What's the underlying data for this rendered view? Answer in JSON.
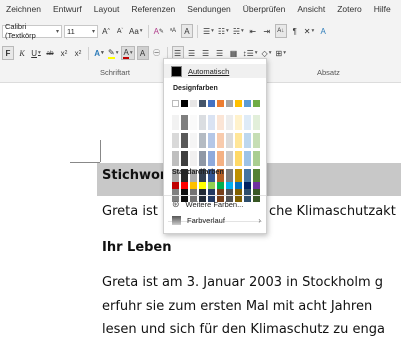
{
  "ribbon": {
    "tabs": [
      "Zeichnen",
      "Entwurf",
      "Layout",
      "Referenzen",
      "Sendungen",
      "Überprüfen",
      "Ansicht",
      "Zotero",
      "Hilfe"
    ],
    "font_name": "Calibri (Textkörp",
    "font_size": "11",
    "groups": {
      "schriftart": "Schriftart",
      "absatz": "Absatz"
    }
  },
  "menu": {
    "automatic_label": "Automatisch",
    "design_colors_title": "Designfarben",
    "standard_colors_title": "Standardfarben",
    "more_colors_label": "Weitere Farben...",
    "gradient_label": "Farbverlauf",
    "theme_top_row": [
      "#ffffff",
      "#000000",
      "#e7e6e6",
      "#44546a",
      "#4472c4",
      "#ed7d31",
      "#a5a5a5",
      "#ffc000",
      "#5b9bd5",
      "#70ad47"
    ],
    "standard_colors": [
      "#c00000",
      "#ff0000",
      "#ffc000",
      "#ffff00",
      "#92d050",
      "#00b050",
      "#00b0f0",
      "#0070c0",
      "#002060",
      "#7030a0"
    ]
  },
  "document": {
    "heading1": "Stichwor",
    "line1_left": "Greta ist",
    "line1_right": "che Klimaschutzakt",
    "heading2": "Ihr Leben",
    "para_line1": "Greta ist am 3. Januar 2003 in Stockholm g",
    "para_line2": "erfuhr sie zum ersten Mal mit acht Jahren",
    "para_line3": "lesen und sich für den Klimaschutz zu enga"
  },
  "accent_colors": {
    "font_color_underline": "#c00000",
    "highlight_yellow": "#ffff00"
  }
}
